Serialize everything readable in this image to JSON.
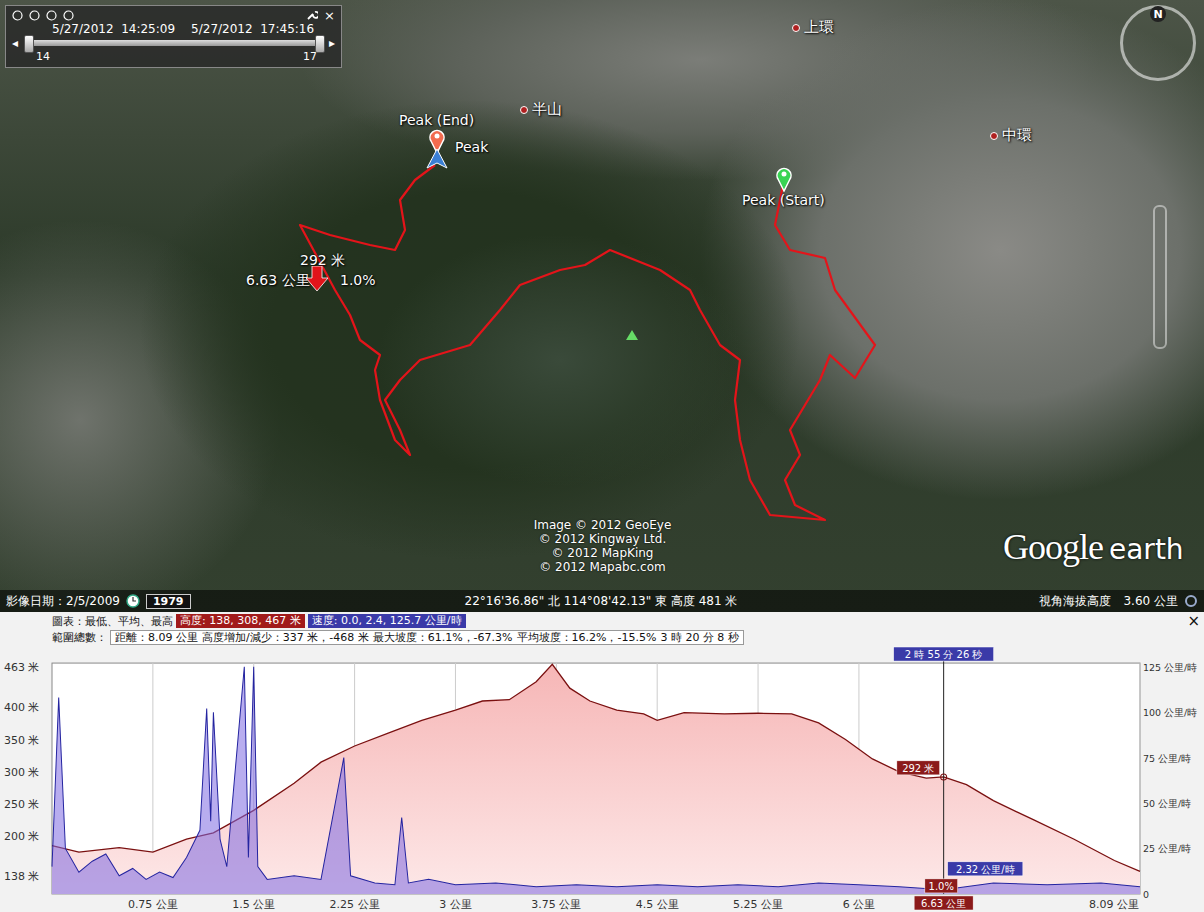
{
  "time_slider": {
    "start": "5/27/2012  14:25:09",
    "end": "5/27/2012  17:45:16",
    "start_label": "14",
    "end_label": "17",
    "level_start": 0.0,
    "level_end": 1.0,
    "close": "×"
  },
  "map": {
    "places": [
      {
        "name": "上環"
      },
      {
        "name": "半山"
      },
      {
        "name": "中環"
      }
    ],
    "placemarks": [
      {
        "label": "Peak (End)",
        "kind": "end",
        "color": "#f26b4f"
      },
      {
        "label": "Peak",
        "kind": "current",
        "color": "#3a7fd5"
      },
      {
        "label": "Peak (Start)",
        "kind": "start",
        "color": "#39d353"
      }
    ],
    "marker": {
      "elevation": "292 米",
      "distance": "6.63 公里",
      "grade": "1.0%"
    },
    "compass": "N",
    "copyright": [
      "Image © 2012 GeoEye",
      "© 2012 Kingway Ltd.",
      "© 2012 MapKing",
      "© 2012 Mapabc.com"
    ],
    "logo": {
      "brand": "Google",
      "product": "earth"
    }
  },
  "status_bar": {
    "imagery_date": "影像日期：2/5/2009",
    "historical_year": "1979",
    "coordinates": "22°16'36.86\" 北 114°08'42.13\" 東 高度  481 米",
    "eye_altitude": "視角海拔高度",
    "eye_value": "3.60 公里"
  },
  "profile": {
    "close": "×",
    "summary_label": "圖表：最低、平均、最高",
    "elevation_stats": "高度: 138, 308, 467 米",
    "speed_stats": "速度: 0.0, 2.4, 125.7 公里/時",
    "range_label": "範圍總數：",
    "range_stats": [
      "距離：8.09 公里",
      "高度增加/減少：337 米，-468 米",
      "最大坡度：61.1%，-67.3%",
      "平均坡度：16.2%，-15.5%",
      "3 時 20 分 8 秒"
    ],
    "elevation_ticks": [
      {
        "label": "463 米",
        "value": 463
      },
      {
        "label": "400 米",
        "value": 400
      },
      {
        "label": "350 米",
        "value": 350
      },
      {
        "label": "300 米",
        "value": 300
      },
      {
        "label": "250 米",
        "value": 250
      },
      {
        "label": "200 米",
        "value": 200
      },
      {
        "label": "138 米",
        "value": 138
      }
    ],
    "speed_ticks": [
      {
        "label": "125 公里/時",
        "value": 125
      },
      {
        "label": "100 公里/時",
        "value": 100
      },
      {
        "label": "75 公里/時",
        "value": 75
      },
      {
        "label": "50 公里/時",
        "value": 50
      },
      {
        "label": "25 公里/時",
        "value": 25
      },
      {
        "label": "0",
        "value": 0
      }
    ],
    "distance_ticks": [
      {
        "label": "0.75 公里",
        "value": 0.75
      },
      {
        "label": "1.5 公里",
        "value": 1.5
      },
      {
        "label": "2.25 公里",
        "value": 2.25
      },
      {
        "label": "3 公里",
        "value": 3
      },
      {
        "label": "3.75 公里",
        "value": 3.75
      },
      {
        "label": "4.5 公里",
        "value": 4.5
      },
      {
        "label": "5.25 公里",
        "value": 5.25
      },
      {
        "label": "6 公里",
        "value": 6
      },
      {
        "label": "8.09 公里",
        "value": 8.09
      }
    ],
    "elevation": {
      "x_km": [
        0,
        0.2,
        0.5,
        0.75,
        1.0,
        1.2,
        1.5,
        1.8,
        2.0,
        2.25,
        2.5,
        2.75,
        3.0,
        3.2,
        3.4,
        3.6,
        3.72,
        3.85,
        4.0,
        4.2,
        4.4,
        4.5,
        4.7,
        5.0,
        5.25,
        5.5,
        5.7,
        5.9,
        6.1,
        6.3,
        6.5,
        6.63,
        6.8,
        7.0,
        7.3,
        7.6,
        7.9,
        8.09
      ],
      "values": [
        185,
        175,
        182,
        175,
        195,
        205,
        240,
        282,
        315,
        340,
        360,
        380,
        396,
        410,
        412,
        440,
        467,
        430,
        410,
        396,
        390,
        380,
        392,
        390,
        391,
        390,
        376,
        350,
        320,
        300,
        290,
        292,
        280,
        255,
        225,
        195,
        162,
        145
      ]
    },
    "speed": {
      "x_km": [
        0,
        0.05,
        0.1,
        0.2,
        0.3,
        0.4,
        0.5,
        0.6,
        0.7,
        0.8,
        0.9,
        1.0,
        1.1,
        1.15,
        1.18,
        1.2,
        1.25,
        1.3,
        1.43,
        1.46,
        1.5,
        1.53,
        1.6,
        1.8,
        2.0,
        2.17,
        2.22,
        2.4,
        2.55,
        2.6,
        2.65,
        2.8,
        3.0,
        3.3,
        3.6,
        3.9,
        4.2,
        4.5,
        4.8,
        5.1,
        5.4,
        5.7,
        6.0,
        6.3,
        6.63,
        7.0,
        7.4,
        7.8,
        8.09
      ],
      "values": [
        15,
        108,
        25,
        12,
        18,
        22,
        10,
        14,
        8,
        12,
        9,
        20,
        35,
        102,
        40,
        100,
        30,
        15,
        125,
        20,
        125,
        15,
        8,
        10,
        8,
        75,
        10,
        6,
        5,
        42,
        6,
        8,
        5,
        6,
        4,
        5,
        4,
        5,
        4,
        5,
        4,
        6,
        5,
        4,
        2.32,
        6,
        5,
        6,
        4
      ]
    },
    "cursor": {
      "distance_km": 6.63,
      "time": "2 時 55 分 26 秒",
      "elevation": "292 米",
      "elevation_value": 292,
      "speed": "2.32 公里/時",
      "grade": "1.0%",
      "distance": "6.63 公里"
    }
  }
}
